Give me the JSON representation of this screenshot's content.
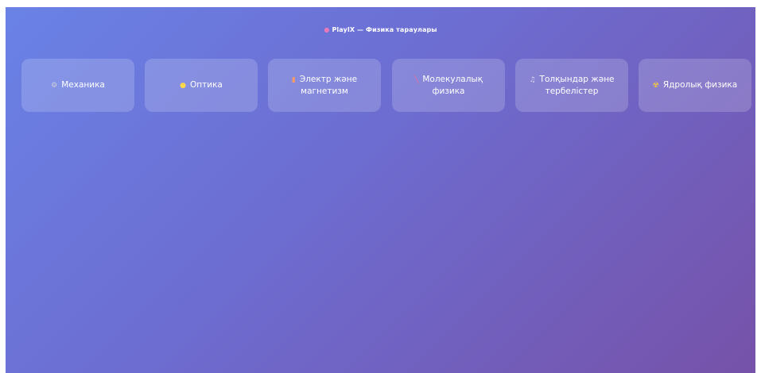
{
  "header": {
    "logo_icon": "brain-icon",
    "logo_glyph": "●",
    "title": "PlayIX — Физика тараулары"
  },
  "colors": {
    "gradient_start": "#6a82e6",
    "gradient_end": "#7652a9",
    "card_bg": "rgba(255,255,255,0.18)"
  },
  "cards": [
    {
      "icon": "gear-icon",
      "glyph": "⚙",
      "label": "Механика"
    },
    {
      "icon": "lightbulb-icon",
      "glyph": "●",
      "label": "Оптика"
    },
    {
      "icon": "plug-icon",
      "glyph": "▮",
      "label": "Электр және магнетизм"
    },
    {
      "icon": "test-tube-icon",
      "glyph": "╲",
      "label": "Молекулалық физика"
    },
    {
      "icon": "music-note-icon",
      "glyph": "♫",
      "label": "Толқындар және тербелістер"
    },
    {
      "icon": "radioactive-icon",
      "glyph": "☢",
      "label": "Ядролық физика"
    }
  ]
}
